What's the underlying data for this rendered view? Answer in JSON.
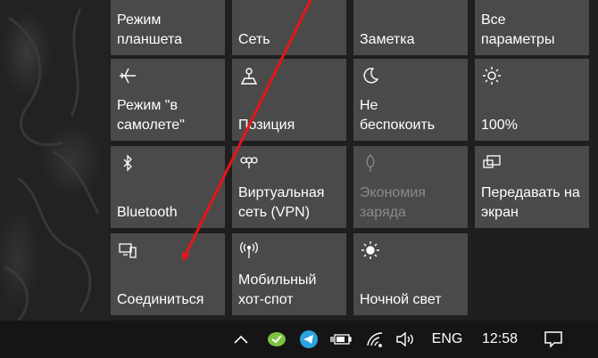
{
  "quick_actions": [
    {
      "id": "tablet",
      "label": "Режим\nпланшета",
      "icon": "tablet-mode-icon",
      "state": "off"
    },
    {
      "id": "network",
      "label": "Сеть",
      "icon": "network-icon",
      "state": "off"
    },
    {
      "id": "note",
      "label": "Заметка",
      "icon": "note-icon",
      "state": "off"
    },
    {
      "id": "settings",
      "label": "Все\nпараметры",
      "icon": "settings-icon",
      "state": "off"
    },
    {
      "id": "airplane",
      "label": "Режим \"в\nсамолете\"",
      "icon": "airplane-icon",
      "state": "off"
    },
    {
      "id": "location",
      "label": "Позиция",
      "icon": "location-icon",
      "state": "off"
    },
    {
      "id": "quiet",
      "label": "Не\nбеспокоить",
      "icon": "moon-icon",
      "state": "off"
    },
    {
      "id": "brightness",
      "label": "100%",
      "icon": "brightness-icon",
      "state": "off"
    },
    {
      "id": "bluetooth",
      "label": "Bluetooth",
      "icon": "bluetooth-icon",
      "state": "off"
    },
    {
      "id": "vpn",
      "label": "Виртуальная\nсеть (VPN)",
      "icon": "vpn-icon",
      "state": "off"
    },
    {
      "id": "battery_saver",
      "label": "Экономия\nзаряда",
      "icon": "battery-saver-icon",
      "state": "disabled"
    },
    {
      "id": "project",
      "label": "Передавать на\nэкран",
      "icon": "project-icon",
      "state": "off"
    },
    {
      "id": "connect",
      "label": "Соединиться",
      "icon": "connect-icon",
      "state": "off"
    },
    {
      "id": "hotspot",
      "label": "Мобильный\nхот-спот",
      "icon": "hotspot-icon",
      "state": "off"
    },
    {
      "id": "night_light",
      "label": "Ночной свет",
      "icon": "night-light-icon",
      "state": "off"
    }
  ],
  "taskbar": {
    "language": "ENG",
    "time": "12:58",
    "icons": [
      "chevron-up-icon",
      "app-tray-icon",
      "telegram-icon",
      "battery-icon",
      "wifi-icon",
      "volume-icon",
      "action-center-icon"
    ]
  },
  "colors": {
    "tile": "#4a4a4a",
    "panel": "#1f1f1f",
    "taskbar": "#151515",
    "arrow": "#e8141a",
    "telegram": "#2aa3e0",
    "tray_app": "#7fc241"
  }
}
